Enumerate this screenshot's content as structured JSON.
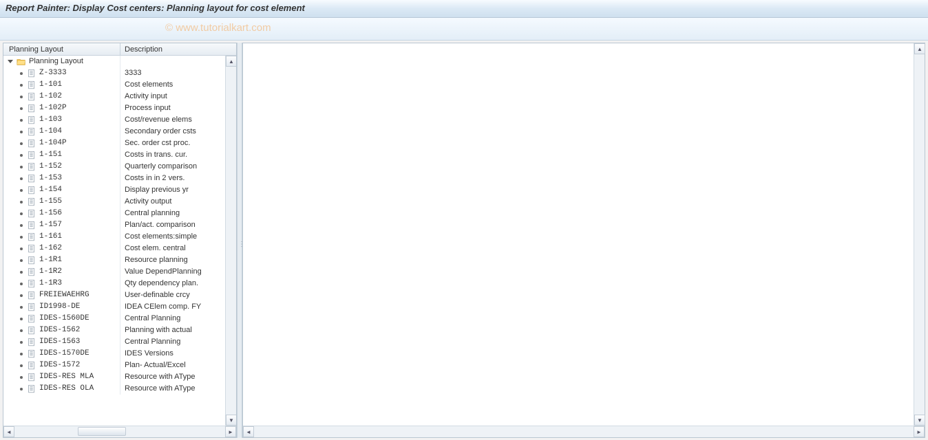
{
  "title": "Report Painter: Display Cost centers: Planning layout for cost element",
  "watermark": "© www.tutorialkart.com",
  "tree": {
    "header_col1": "Planning Layout",
    "header_col2": "Description",
    "root": {
      "name": "Planning Layout",
      "description": ""
    },
    "items": [
      {
        "name": "Z-3333",
        "description": "3333"
      },
      {
        "name": "1-101",
        "description": "Cost elements"
      },
      {
        "name": "1-102",
        "description": "Activity input"
      },
      {
        "name": "1-102P",
        "description": "Process input"
      },
      {
        "name": "1-103",
        "description": "Cost/revenue elems"
      },
      {
        "name": "1-104",
        "description": "Secondary order csts"
      },
      {
        "name": "1-104P",
        "description": "Sec. order cst proc."
      },
      {
        "name": "1-151",
        "description": "Costs in trans. cur."
      },
      {
        "name": "1-152",
        "description": "Quarterly comparison"
      },
      {
        "name": "1-153",
        "description": "Costs in in 2 vers."
      },
      {
        "name": "1-154",
        "description": "Display previous yr"
      },
      {
        "name": "1-155",
        "description": "Activity output"
      },
      {
        "name": "1-156",
        "description": "Central planning"
      },
      {
        "name": "1-157",
        "description": "Plan/act. comparison"
      },
      {
        "name": "1-161",
        "description": "Cost elements:simple"
      },
      {
        "name": "1-162",
        "description": "Cost elem. central"
      },
      {
        "name": "1-1R1",
        "description": "Resource planning"
      },
      {
        "name": "1-1R2",
        "description": "Value DependPlanning"
      },
      {
        "name": "1-1R3",
        "description": "Qty dependency plan."
      },
      {
        "name": "FREIEWAEHRG",
        "description": "User-definable crcy"
      },
      {
        "name": "ID1998-DE",
        "description": "IDEA CElem comp. FY"
      },
      {
        "name": "IDES-1560DE",
        "description": "Central Planning"
      },
      {
        "name": "IDES-1562",
        "description": "Planning with actual"
      },
      {
        "name": "IDES-1563",
        "description": "Central Planning"
      },
      {
        "name": "IDES-1570DE",
        "description": "IDES Versions"
      },
      {
        "name": "IDES-1572",
        "description": "Plan- Actual/Excel"
      },
      {
        "name": "IDES-RES MLA",
        "description": "Resource with AType"
      },
      {
        "name": "IDES-RES OLA",
        "description": "Resource with AType"
      }
    ]
  }
}
